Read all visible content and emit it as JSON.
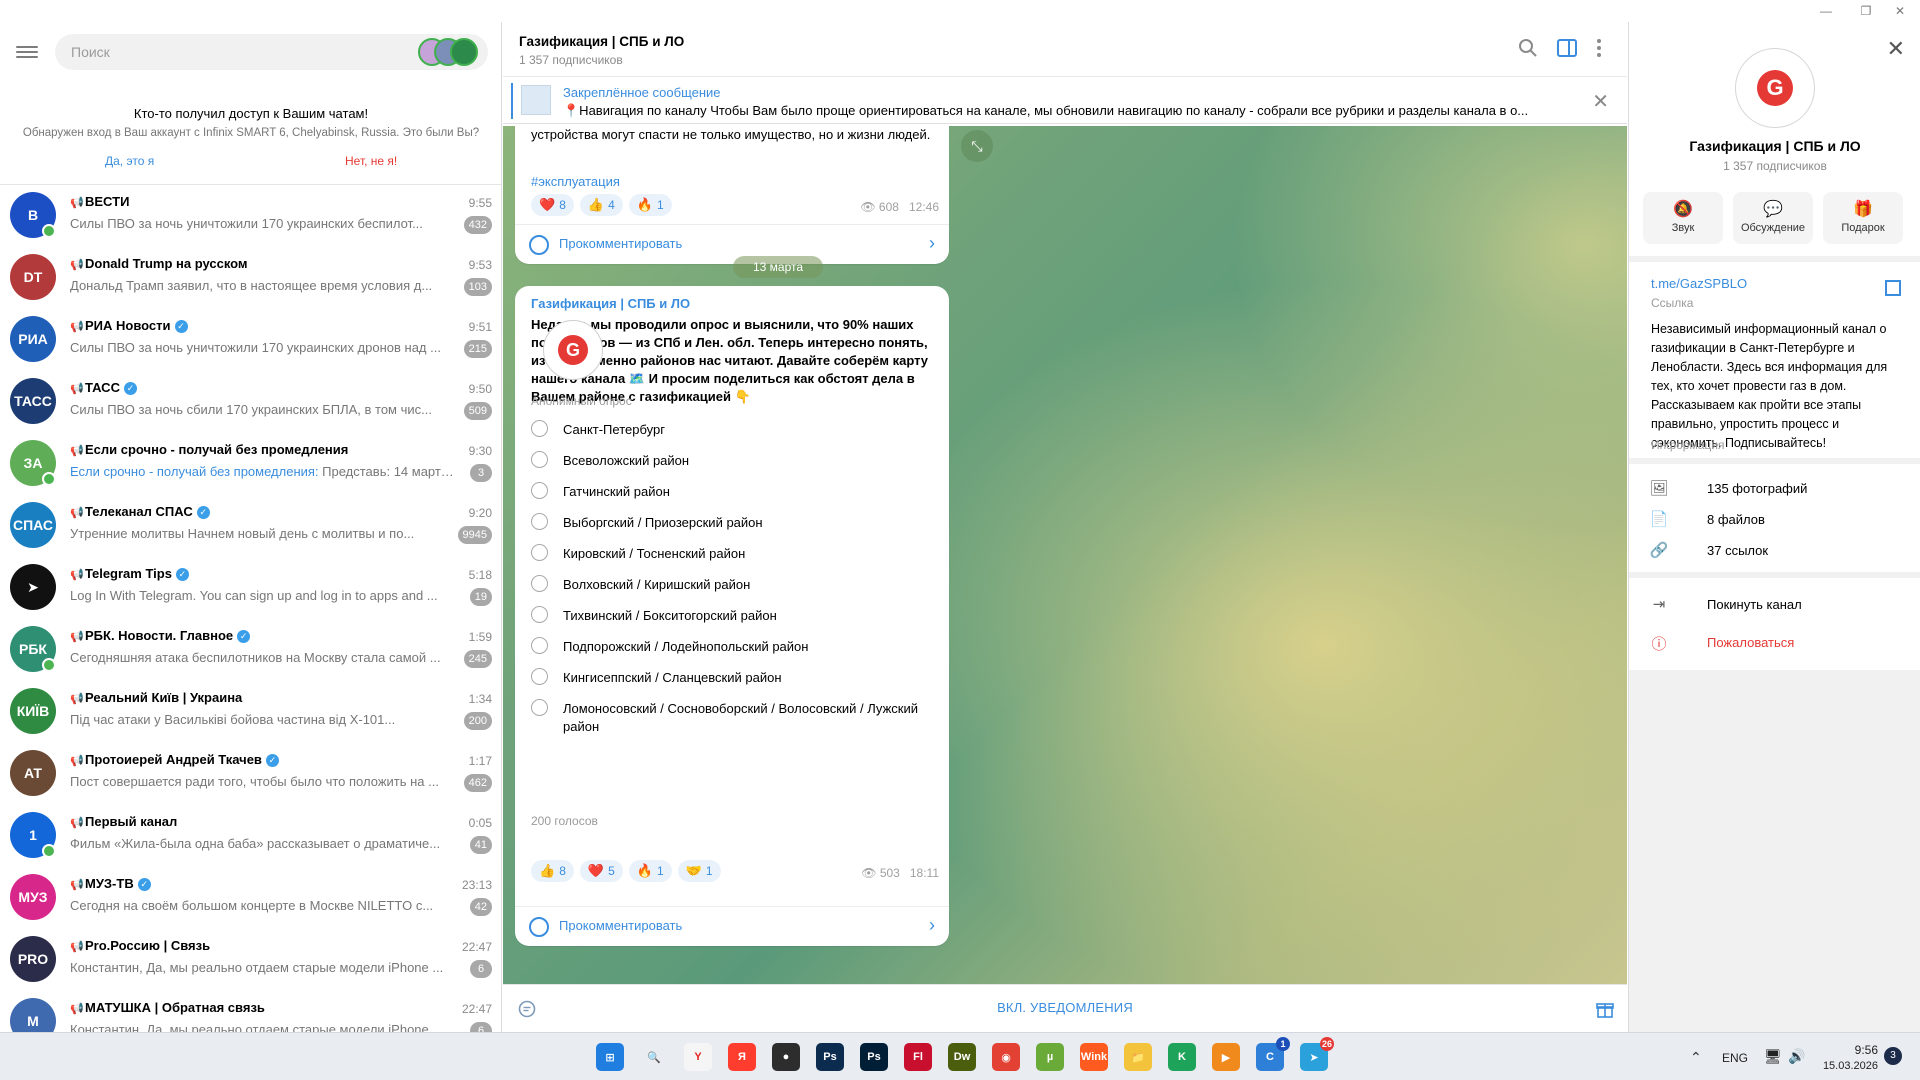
{
  "window": {
    "minimize": "—",
    "maximize": "❐",
    "close": "✕"
  },
  "search": {
    "placeholder": "Поиск"
  },
  "login_notice": {
    "title": "Кто-то получил доступ к Вашим чатам!",
    "text": "Обнаружен вход в Ваш аккаунт с Infinix SMART 6, Chelyabinsk, Russia. Это были Вы?",
    "yes": "Да, это я",
    "no": "Нет, не я!"
  },
  "chats": [
    {
      "title": "ВЕСТИ",
      "verified": false,
      "time": "9:55",
      "preview": "Силы ПВО за ночь уничтожили 170 украинских беспилот...",
      "badge": "432",
      "avatar_color": "#1d4fc4",
      "avatar_text": "B"
    },
    {
      "title": "Donald Trump на русском",
      "verified": false,
      "time": "9:53",
      "preview": "Дональд Трамп заявил, что в настоящее время условия д...",
      "badge": "103",
      "avatar_color": "#b23a3a",
      "avatar_text": "DT"
    },
    {
      "title": "РИА Новости",
      "verified": true,
      "time": "9:51",
      "preview": "Силы ПВО за ночь уничтожили 170 украинских дронов над ...",
      "badge": "215",
      "avatar_color": "#1f5fb8",
      "avatar_text": "РИА"
    },
    {
      "title": "ТАСС",
      "verified": true,
      "time": "9:50",
      "preview": "Силы ПВО за ночь сбили 170 украинских БПЛА, в том чис...",
      "badge": "509",
      "avatar_color": "#1d3c73",
      "avatar_text": "ТАСС"
    },
    {
      "title": "Если срочно - получай без промедления",
      "verified": false,
      "time": "9:30",
      "preview_prefix": "Если срочно - получай без промедления:",
      "preview": " Представь: 14 марта ...",
      "badge": "3",
      "avatar_color": "#5fae57",
      "avatar_text": "ЗА"
    },
    {
      "title": "Телеканал СПАС",
      "verified": true,
      "time": "9:20",
      "preview": "Утренние молитвы  Начнем новый день с молитвы и по...",
      "badge": "9945",
      "avatar_color": "#1a7fc1",
      "avatar_text": "СПАС"
    },
    {
      "title": "Telegram Tips",
      "verified": true,
      "time": "5:18",
      "preview": "Log In With Telegram. You can sign up and log in to apps and ...",
      "badge": "19",
      "avatar_color": "#111111",
      "avatar_text": "➤"
    },
    {
      "title": "РБК. Новости. Главное",
      "verified": true,
      "time": "1:59",
      "preview": "Сегодняшняя атака беспилотников на Москву стала самой ...",
      "badge": "245",
      "avatar_color": "#2e8f72",
      "avatar_text": "РБК"
    },
    {
      "title": "Реальний Київ | Украина",
      "verified": false,
      "time": "1:34",
      "preview": "Під час атаки у Васильківі бойова частина від Х-101...",
      "badge": "200",
      "avatar_color": "#2f8a42",
      "avatar_text": "КИЇВ"
    },
    {
      "title": "Протоиерей Андрей Ткачев",
      "verified": true,
      "time": "1:17",
      "preview": "Пост совершается ради того, чтобы было что положить на ...",
      "badge": "462",
      "avatar_color": "#6b4a35",
      "avatar_text": "АТ"
    },
    {
      "title": "Первый канал",
      "verified": false,
      "time": "0:05",
      "preview": "Фильм «Жила-была одна баба» рассказывает о драматиче...",
      "badge": "41",
      "avatar_color": "#1467d8",
      "avatar_text": "1"
    },
    {
      "title": "МУЗ-ТВ",
      "verified": true,
      "time": "23:13",
      "preview": "Сегодня на своём большом концерте в Москве NILETTO с...",
      "badge": "42",
      "avatar_color": "#d8278a",
      "avatar_text": "МУЗ"
    },
    {
      "title": "Pro.Россию | Связь",
      "verified": false,
      "time": "22:47",
      "preview": "Константин, Да, мы реально отдаем старые модели iPhone ...",
      "badge": "6",
      "avatar_color": "#2b2b4a",
      "avatar_text": "PRO"
    },
    {
      "title": "МАТУШКА | Обратная связь",
      "verified": false,
      "time": "22:47",
      "preview": "Константин, Да, мы реально отдаем старые модели iPhone ...",
      "badge": "6",
      "avatar_color": "#3f6ab0",
      "avatar_text": "М"
    }
  ],
  "channel": {
    "title": "Газификация | СПБ и ЛО",
    "subscribers": "1 357 подписчиков"
  },
  "pinned": {
    "title": "Закреплённое сообщение",
    "text": "📍Навигация по каналу  Чтобы Вам было проще ориентироваться на канале, мы обновили навигацию по каналу - собрали все рубрики и разделы канала в о..."
  },
  "message1": {
    "text": "устройства могут спасти не только имущество, но и жизни людей.",
    "hashtag": "#эксплуатация",
    "reactions": [
      {
        "emoji": "❤️",
        "count": "8"
      },
      {
        "emoji": "👍",
        "count": "4"
      },
      {
        "emoji": "🔥",
        "count": "1"
      }
    ],
    "views": "608",
    "time": "12:46",
    "comment": "Прокомментировать"
  },
  "date_separator": "13 марта",
  "message2": {
    "sender": "Газификация | СПБ и ЛО",
    "text": "Недавно мы проводили опрос и выяснили, что 90% наших подписчиков — из СПб и Лен. обл. Теперь интересно понять, из каких именно районов нас читают. Давайте соберём карту нашего канала 🗺️ И просим поделиться как обстоят дела в Вашем районе с газификацией 👇",
    "poll_type": "Анонимный опрос",
    "options": [
      "Санкт-Петербург",
      "Всеволожский район",
      "Гатчинский район",
      "Выборгский / Приозерский район",
      "Кировский / Тосненский район",
      "Волховский / Киришский район",
      "Тихвинский / Бокситогорский район",
      "Подпорожский / Лодейнопольский район",
      "Кингисеппский / Сланцевский район",
      "Ломоносовский / Сосновоборский / Волосовский / Лужский район"
    ],
    "votes": "200 голосов",
    "reactions": [
      {
        "emoji": "👍",
        "count": "8"
      },
      {
        "emoji": "❤️",
        "count": "5"
      },
      {
        "emoji": "🔥",
        "count": "1"
      },
      {
        "emoji": "🤝",
        "count": "1"
      }
    ],
    "views": "503",
    "time": "18:11",
    "comment": "Прокомментировать"
  },
  "bottom": {
    "notifications": "ВКЛ. УВЕДОМЛЕНИЯ"
  },
  "profile": {
    "title": "Газификация | СПБ и ЛО",
    "subscribers": "1 357 подписчиков",
    "actions": [
      {
        "icon": "🔕",
        "label": "Звук"
      },
      {
        "icon": "💬",
        "label": "Обсуждение"
      },
      {
        "icon": "🎁",
        "label": "Подарок"
      }
    ],
    "link": "t.me/GazSPBLO",
    "link_label": "Ссылка",
    "description": "Независимый информационный канал о газификации в Санкт-Петербурге и Ленобласти. Здесь вся информация для тех, кто хочет провести газ в дом. Рассказываем как пройти все этапы правильно, упростить процесс и сэкономить. Подписывайтесь!",
    "description_label": "Информация",
    "media": [
      {
        "icon": "🖼",
        "label": "135 фотографий"
      },
      {
        "icon": "📄",
        "label": "8 файлов"
      },
      {
        "icon": "🔗",
        "label": "37 ссылок"
      }
    ],
    "leave": "Покинуть канал",
    "report": "Пожаловаться"
  },
  "taskbar": {
    "lang": "ENG",
    "time": "9:56",
    "date": "15.03.2026",
    "notif_count": "3",
    "apps": [
      {
        "name": "start",
        "color": "#1f7ee0",
        "glyph": "⊞"
      },
      {
        "name": "search",
        "color": "#e9edf2",
        "glyph": "🔍"
      },
      {
        "name": "yandex-browser",
        "color": "#f5f5f5",
        "glyph": "Y"
      },
      {
        "name": "yandex",
        "color": "#ff3d2e",
        "glyph": "Я"
      },
      {
        "name": "camtasia",
        "color": "#2d2d2d",
        "glyph": "●"
      },
      {
        "name": "photoshop-1",
        "color": "#0b2b4f",
        "glyph": "Ps"
      },
      {
        "name": "photoshop-2",
        "color": "#001e36",
        "glyph": "Ps"
      },
      {
        "name": "flash",
        "color": "#c8102e",
        "glyph": "Fl"
      },
      {
        "name": "dreamweaver",
        "color": "#4b5e0e",
        "glyph": "Dw"
      },
      {
        "name": "chrome",
        "color": "#e34133",
        "glyph": "◉"
      },
      {
        "name": "utorrent",
        "color": "#6aaa38",
        "glyph": "µ"
      },
      {
        "name": "wink",
        "color": "#ff5a1f",
        "glyph": "Wink"
      },
      {
        "name": "explorer",
        "color": "#f3c33c",
        "glyph": "📁"
      },
      {
        "name": "kaspersky",
        "color": "#1ea45a",
        "glyph": "K"
      },
      {
        "name": "media-player",
        "color": "#f08a1c",
        "glyph": "▶"
      },
      {
        "name": "copilot",
        "color": "#2e7fd8",
        "glyph": "C"
      },
      {
        "name": "telegram",
        "color": "#2aa1da",
        "glyph": "➤"
      }
    ],
    "telegram_badge": "26",
    "copilot_badge": "1"
  }
}
